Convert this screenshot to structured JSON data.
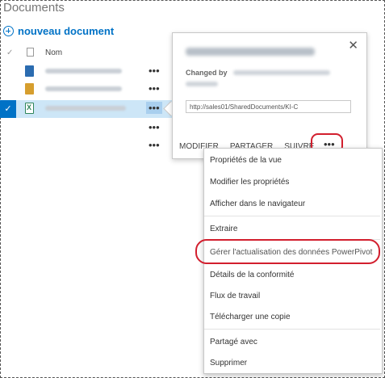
{
  "library": {
    "title": "Documents",
    "new_document_label": "nouveau document",
    "column_name": "Nom"
  },
  "rows": [
    {
      "icon": "word-document-icon"
    },
    {
      "icon": "warning-document-icon"
    },
    {
      "icon": "excel-document-icon",
      "selected": true
    }
  ],
  "ellipsis": "•••",
  "callout": {
    "changed_by_label": "Changed by",
    "url_value": "http://sales01/SharedDocuments/KI-C",
    "actions": [
      "MODIFIER",
      "PARTAGER",
      "SUIVRE"
    ],
    "close_glyph": "✕"
  },
  "menu": {
    "items": [
      "Propriétés de la vue",
      "Modifier les propriétés",
      "Afficher dans le navigateur",
      "Extraire",
      "Gérer l'actualisation des données PowerPivot",
      "Détails de la conformité",
      "Flux de travail",
      "Télécharger une copie",
      "Partagé avec",
      "Supprimer"
    ]
  },
  "colors": {
    "accent": "#0072c6",
    "highlight_ring": "#d21f2e",
    "selected_row": "#cde6f7"
  }
}
